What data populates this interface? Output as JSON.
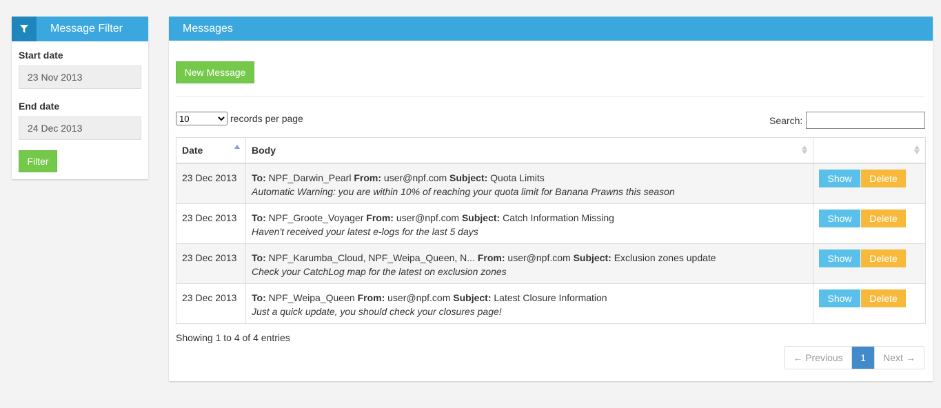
{
  "filter": {
    "title": "Message Filter",
    "start_label": "Start date",
    "start_value": "23 Nov 2013",
    "end_label": "End date",
    "end_value": "24 Dec 2013",
    "button": "Filter"
  },
  "messages": {
    "title": "Messages",
    "new_button": "New Message",
    "length_value": "10",
    "length_text": "records per page",
    "search_label": "Search:",
    "columns": [
      "Date",
      "Body",
      ""
    ],
    "rows": [
      {
        "date": "23 Dec 2013",
        "to": "NPF_Darwin_Pearl",
        "from": "user@npf.com",
        "subject": "Quota Limits",
        "preview": "Automatic Warning: you are within 10% of reaching your quota limit for Banana Prawns this season"
      },
      {
        "date": "23 Dec 2013",
        "to": "NPF_Groote_Voyager",
        "from": "user@npf.com",
        "subject": "Catch Information Missing",
        "preview": "Haven't received your latest e-logs for the last 5 days"
      },
      {
        "date": "23 Dec 2013",
        "to": "NPF_Karumba_Cloud, NPF_Weipa_Queen, N...",
        "from": "user@npf.com",
        "subject": "Exclusion zones update",
        "preview": "Check your CatchLog map for the latest on exclusion zones"
      },
      {
        "date": "23 Dec 2013",
        "to": "NPF_Weipa_Queen",
        "from": "user@npf.com",
        "subject": "Latest Closure Information",
        "preview": "Just a quick update, you should check your closures page!"
      }
    ],
    "labels": {
      "to": "To:",
      "from": "From:",
      "subject": "Subject:"
    },
    "show_button": "Show",
    "delete_button": "Delete",
    "info": "Showing 1 to 4 of 4 entries",
    "pager": {
      "prev": "← Previous",
      "current": "1",
      "next": "Next →"
    }
  },
  "colors": {
    "header_blue": "#3aa8de",
    "filter_icon_bg": "#1f86bd",
    "green": "#74c94b",
    "show_blue": "#5bc0e9",
    "delete_orange": "#f8b93b",
    "page_active": "#428bca"
  },
  "icons": {
    "filter": "funnel-icon"
  }
}
